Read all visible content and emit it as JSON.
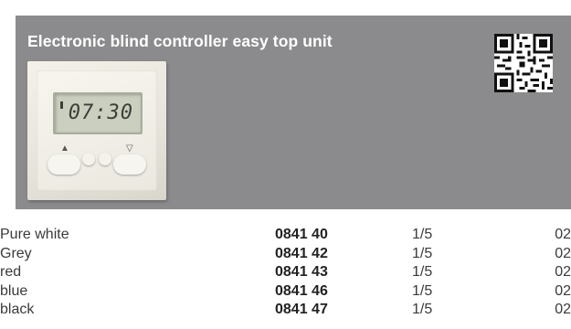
{
  "banner": {
    "title": "Electronic blind controller easy top unit",
    "background_color": "#8b8b8d"
  },
  "device": {
    "display_time": "07:30"
  },
  "products": [
    {
      "name": "Pure white",
      "code": "0841 40",
      "pack": "1/5",
      "group": "02"
    },
    {
      "name": "Grey",
      "code": "0841 42",
      "pack": "1/5",
      "group": "02"
    },
    {
      "name": "red",
      "code": "0841 43",
      "pack": "1/5",
      "group": "02"
    },
    {
      "name": "blue",
      "code": "0841 46",
      "pack": "1/5",
      "group": "02"
    },
    {
      "name": "black",
      "code": "0841 47",
      "pack": "1/5",
      "group": "02"
    }
  ]
}
